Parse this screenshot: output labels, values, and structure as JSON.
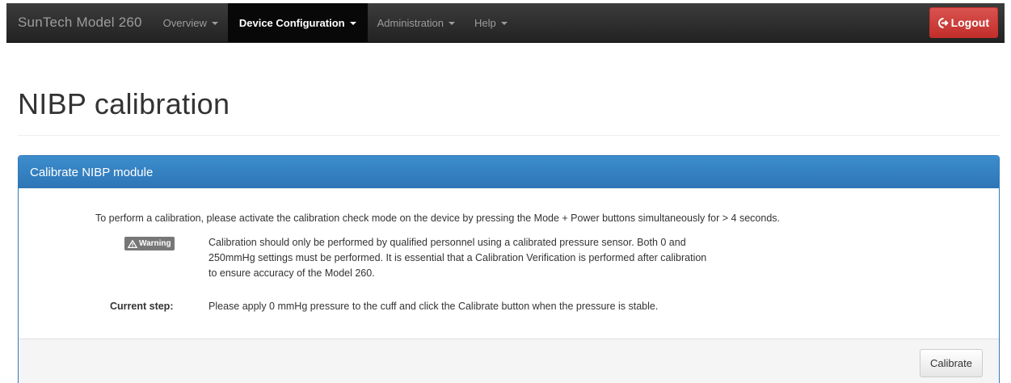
{
  "navbar": {
    "brand": "SunTech Model 260",
    "items": [
      {
        "label": "Overview",
        "active": false
      },
      {
        "label": "Device Configuration",
        "active": true
      },
      {
        "label": "Administration",
        "active": false
      },
      {
        "label": "Help",
        "active": false
      }
    ],
    "logout_label": "Logout",
    "logout_icon": "logout-icon",
    "logout_color": "#d9534f"
  },
  "page": {
    "title": "NIBP calibration"
  },
  "panel": {
    "heading": "Calibrate NIBP module",
    "heading_color": "#337ab7",
    "intro": "To perform a calibration, please activate the calibration check mode on the device by pressing the Mode + Power buttons simultaneously for > 4 seconds.",
    "warning_badge": "Warning",
    "warning_icon": "warning-triangle-icon",
    "warning_lines": [
      "Calibration should only be performed by qualified personnel using a calibrated pressure sensor. Both 0 and",
      "250mmHg settings must be performed. It is essential that a Calibration Verification is performed after calibration",
      "to ensure accuracy of the Model 260."
    ],
    "current_step_label": "Current step:",
    "current_step_text": "Please apply 0 mmHg pressure to the cuff and click the Calibrate button when the pressure is stable.",
    "calibrate_label": "Calibrate"
  }
}
